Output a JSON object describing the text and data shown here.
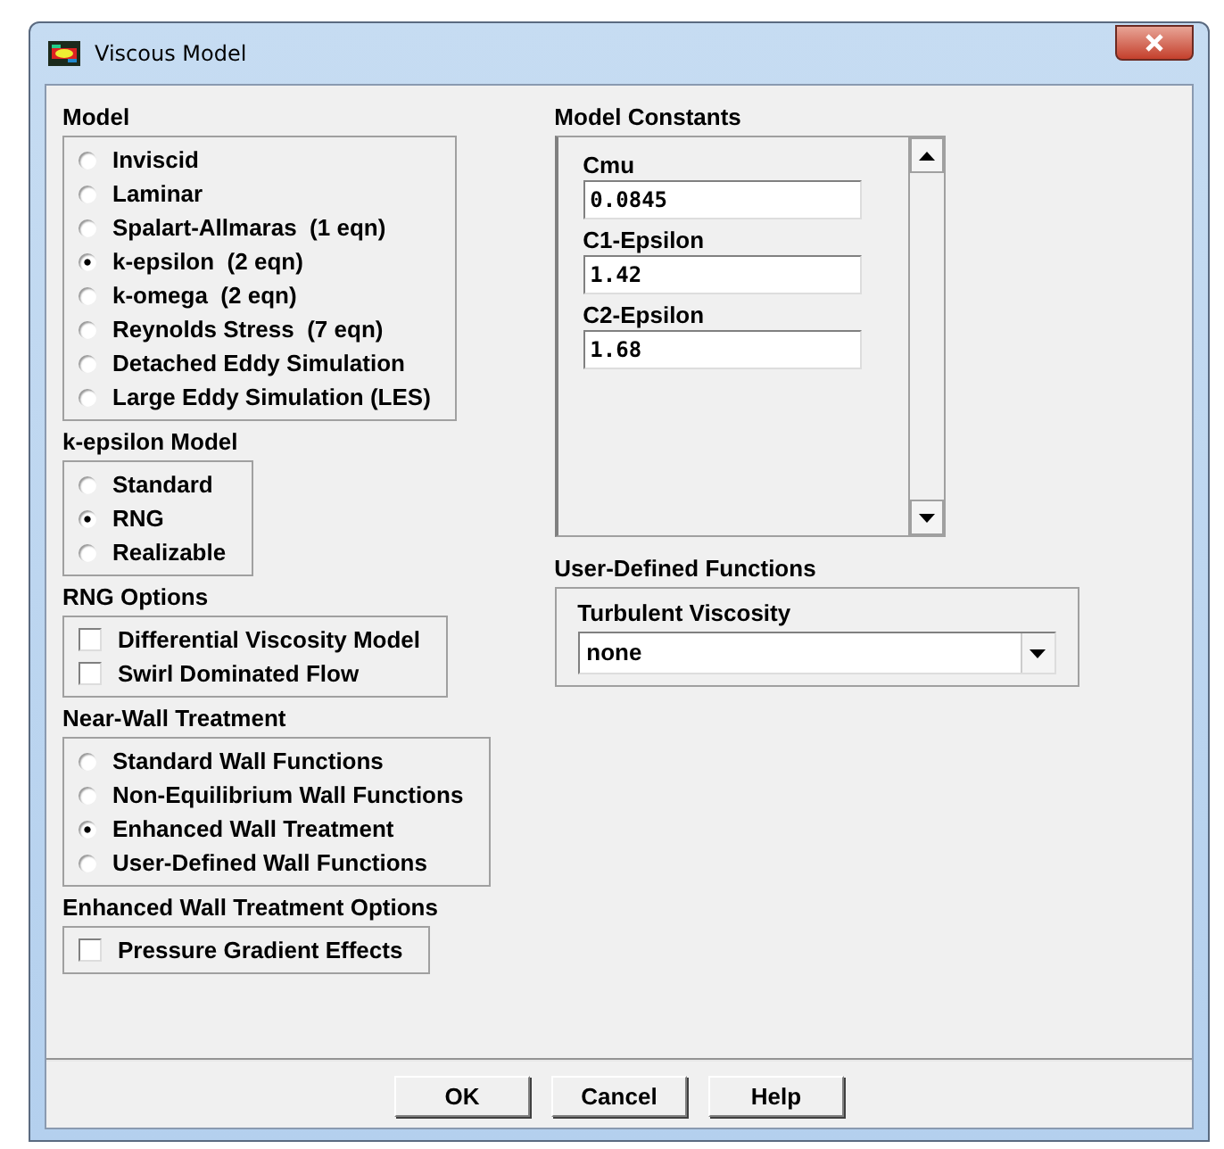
{
  "window": {
    "title": "Viscous Model"
  },
  "left_groups": [
    {
      "heading": "Model",
      "kind": "radio",
      "items": [
        {
          "label": "Inviscid",
          "selected": false
        },
        {
          "label": "Laminar",
          "selected": false
        },
        {
          "label": "Spalart-Allmaras  (1 eqn)",
          "selected": false
        },
        {
          "label": "k-epsilon  (2 eqn)",
          "selected": true
        },
        {
          "label": "k-omega  (2 eqn)",
          "selected": false
        },
        {
          "label": "Reynolds Stress  (7 eqn)",
          "selected": false
        },
        {
          "label": "Detached Eddy Simulation",
          "selected": false
        },
        {
          "label": "Large Eddy Simulation (LES)",
          "selected": false
        }
      ]
    },
    {
      "heading": "k-epsilon Model",
      "kind": "radio",
      "items": [
        {
          "label": "Standard",
          "selected": false
        },
        {
          "label": "RNG",
          "selected": true
        },
        {
          "label": "Realizable",
          "selected": false
        }
      ]
    },
    {
      "heading": "RNG Options",
      "kind": "checkbox",
      "items": [
        {
          "label": "Differential Viscosity Model",
          "checked": false
        },
        {
          "label": "Swirl Dominated Flow",
          "checked": false
        }
      ]
    },
    {
      "heading": "Near-Wall Treatment",
      "kind": "radio",
      "items": [
        {
          "label": "Standard Wall Functions",
          "selected": false
        },
        {
          "label": "Non-Equilibrium Wall Functions",
          "selected": false
        },
        {
          "label": "Enhanced Wall Treatment",
          "selected": true
        },
        {
          "label": "User-Defined Wall Functions",
          "selected": false
        }
      ]
    },
    {
      "heading": "Enhanced Wall Treatment Options",
      "kind": "checkbox",
      "items": [
        {
          "label": "Pressure Gradient Effects",
          "checked": false
        }
      ]
    }
  ],
  "model_constants": {
    "heading": "Model Constants",
    "fields": [
      {
        "label": "Cmu",
        "value": "0.0845"
      },
      {
        "label": "C1-Epsilon",
        "value": "1.42"
      },
      {
        "label": "C2-Epsilon",
        "value": "1.68"
      }
    ]
  },
  "user_defined_functions": {
    "heading": "User-Defined Functions",
    "label": "Turbulent Viscosity",
    "value": "none"
  },
  "buttons": [
    "OK",
    "Cancel",
    "Help"
  ]
}
